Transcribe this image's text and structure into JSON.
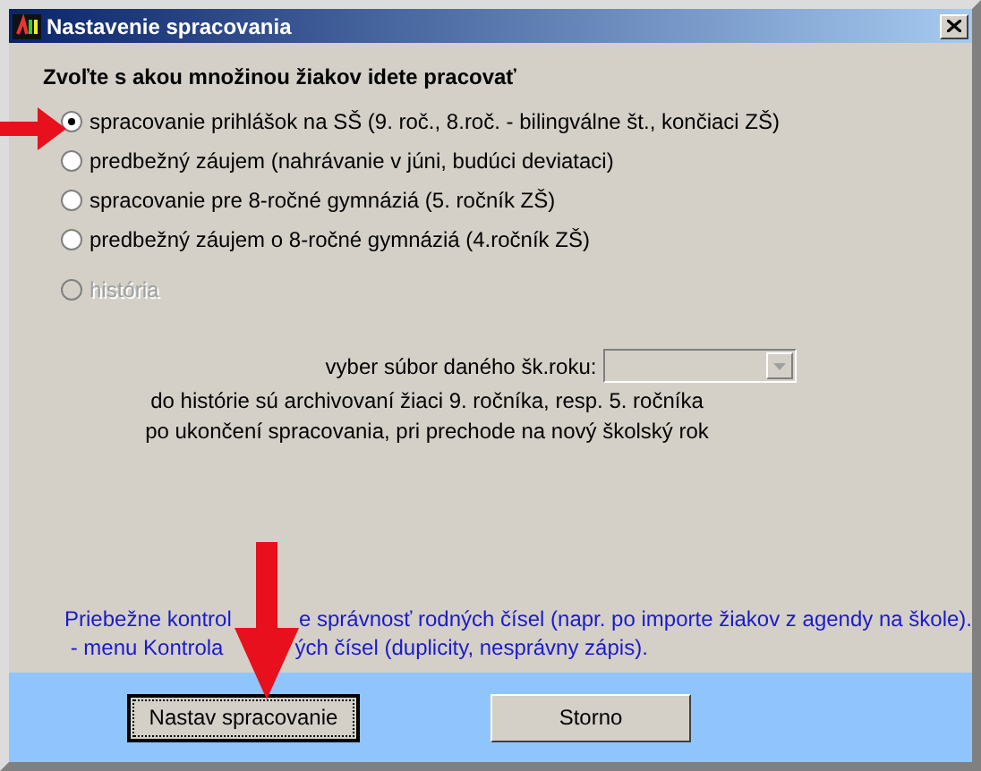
{
  "window": {
    "title": "Nastavenie spracovania"
  },
  "heading": "Zvoľte s akou množinou žiakov idete pracovať",
  "options": [
    {
      "label": "spracovanie prihlášok na SŠ (9. roč., 8.roč. - bilingválne št., končiaci ZŠ)",
      "selected": true,
      "disabled": false
    },
    {
      "label": "predbežný záujem (nahrávanie v júni, budúci deviataci)",
      "selected": false,
      "disabled": false
    },
    {
      "label": "spracovanie pre 8-ročné gymnáziá (5. ročník ZŠ)",
      "selected": false,
      "disabled": false
    },
    {
      "label": "predbežný záujem o 8-ročné gymnáziá (4.ročník ZŠ)",
      "selected": false,
      "disabled": false
    },
    {
      "label": "história",
      "selected": false,
      "disabled": true
    }
  ],
  "history": {
    "file_label": "vyber súbor daného šk.roku:",
    "note_lines": [
      "do histórie sú archivovaní žiaci 9. ročníka, resp. 5. ročníka",
      "po ukončení spracovania, pri prechode na nový školský rok"
    ]
  },
  "info_lines": [
    [
      "Priebežne kontrol",
      "e správnosť rodných čísel (napr. po importe žiakov z agendy na škole)."
    ],
    [
      " - menu Kontrola",
      "ých čísel (duplicity, nesprávny zápis)."
    ]
  ],
  "buttons": [
    {
      "label": "Nastav spracovanie",
      "focused": true
    },
    {
      "label": "Storno",
      "focused": false
    }
  ]
}
